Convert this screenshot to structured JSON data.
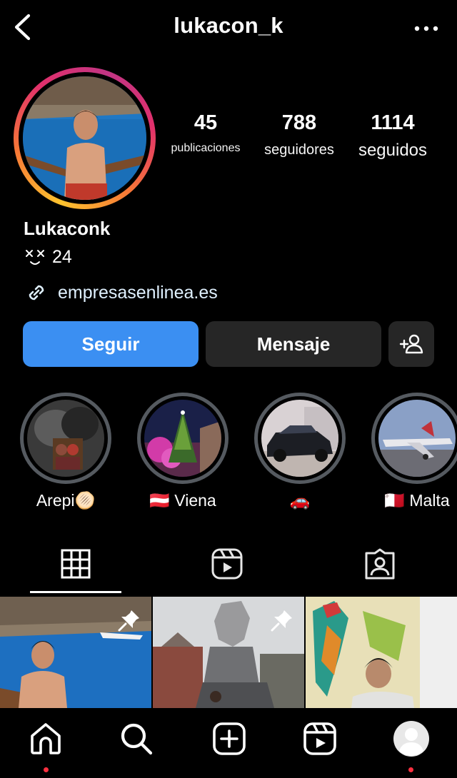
{
  "header": {
    "username": "lukacon_k",
    "back_icon": "chevron-left-icon",
    "more_icon": "more-horizontal-icon"
  },
  "profile": {
    "display_name": "Lukaconk",
    "bio_text": "24",
    "bio_emoji": "dizzy-face-emoji",
    "link": "empresasenlinea.es",
    "stats": [
      {
        "value": "45",
        "label": "publicaciones"
      },
      {
        "value": "788",
        "label": "seguidores"
      },
      {
        "value": "1114",
        "label": "seguidos"
      }
    ]
  },
  "actions": {
    "follow": "Seguir",
    "message": "Mensaje",
    "suggest_icon": "add-person-icon"
  },
  "highlights": [
    {
      "label": "Arepi🫓"
    },
    {
      "label": "🇦🇹  Viena"
    },
    {
      "label": "🚗"
    },
    {
      "label": "🇲🇹  Malta"
    }
  ],
  "tabs": [
    "grid-icon",
    "reels-icon",
    "tagged-icon"
  ],
  "bottom_nav": [
    "home-icon",
    "search-icon",
    "create-icon",
    "reels-icon",
    "profile-avatar"
  ],
  "colors": {
    "accent": "#3b8ff2",
    "button_dark": "#262626",
    "notification": "#ff3040",
    "link": "#e0f1ff"
  }
}
